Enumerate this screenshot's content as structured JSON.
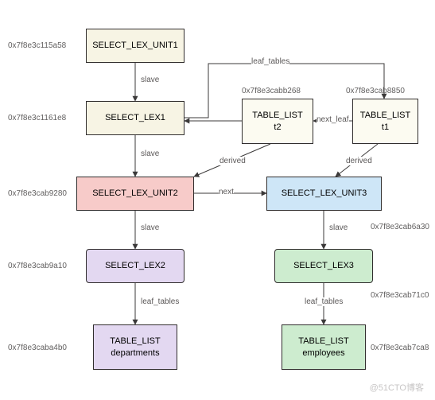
{
  "nodes": {
    "unit1": {
      "label": "SELECT_LEX_UNIT1",
      "addr": "0x7f8e3c115a58",
      "fill": "#f7f4e4"
    },
    "lex1": {
      "label": "SELECT_LEX1",
      "addr": "0x7f8e3c1161e8",
      "fill": "#f7f4e4"
    },
    "tl_t2": {
      "line1": "TABLE_LIST",
      "line2": "t2",
      "addr": "0x7f8e3cabb268",
      "fill": "#fcfbf1"
    },
    "tl_t1": {
      "line1": "TABLE_LIST",
      "line2": "t1",
      "addr": "0x7f8e3cab8850",
      "fill": "#fcfbf1"
    },
    "unit2": {
      "label": "SELECT_LEX_UNIT2",
      "addr": "0x7f8e3cab9280",
      "fill": "#f7cbc9"
    },
    "unit3": {
      "label": "SELECT_LEX_UNIT3",
      "addr": "0x7f8e3cab6a30",
      "fill": "#cee6f7"
    },
    "lex2": {
      "label": "SELECT_LEX2",
      "addr": "0x7f8e3cab9a10",
      "fill": "#e3d8f1"
    },
    "lex3": {
      "label": "SELECT_LEX3",
      "addr": "0x7f8e3cab71c0",
      "fill": "#cdeccf"
    },
    "tl_dep": {
      "line1": "TABLE_LIST",
      "line2": "departments",
      "addr": "0x7f8e3caba4b0",
      "fill": "#e3d8f1"
    },
    "tl_emp": {
      "line1": "TABLE_LIST",
      "line2": "employees",
      "addr": "0x7f8e3cab7ca8",
      "fill": "#cdeccf"
    }
  },
  "edges": {
    "slave": "slave",
    "leaf_tables": "leaf_tables",
    "next_leaf": "next_leaf",
    "derived": "derived",
    "next": "next"
  },
  "watermark": "@51CTO博客"
}
